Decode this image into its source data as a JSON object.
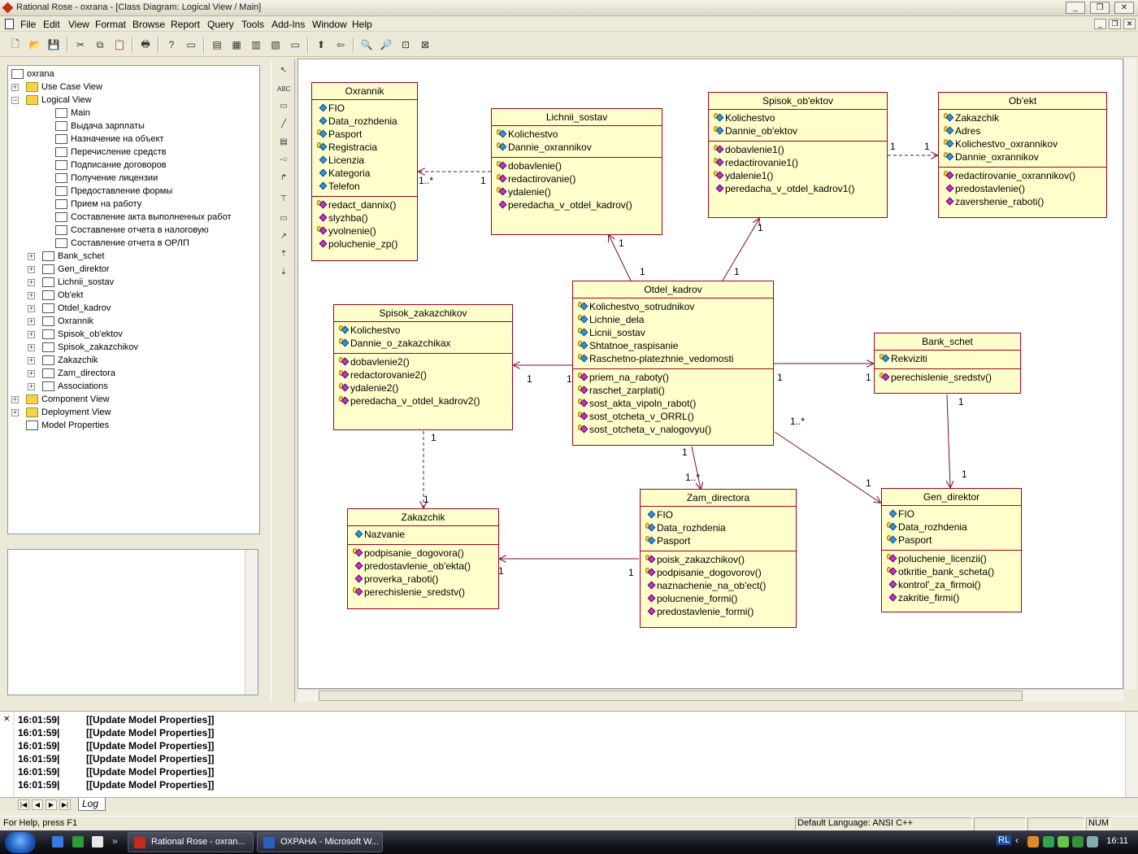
{
  "window": {
    "title": "Rational Rose - oxrana - [Class Diagram: Logical View / Main]",
    "controls": [
      "_",
      "❐",
      "✕"
    ],
    "mdi_controls": [
      "_",
      "❐",
      "✕"
    ]
  },
  "menu": [
    "File",
    "Edit",
    "View",
    "Format",
    "Browse",
    "Report",
    "Query",
    "Tools",
    "Add-Ins",
    "Window",
    "Help"
  ],
  "toolbar": {
    "icons": [
      "new-icon",
      "open-icon",
      "save-icon",
      "cut-icon",
      "copy-icon",
      "paste-icon",
      "print-icon",
      "context-help-icon",
      "view-doc-icon",
      "browse-class-icon",
      "browse-interaction-icon",
      "browse-component-icon",
      "browse-deployment-icon",
      "browse-parent-icon",
      "browse-previous-icon",
      "zoom-in-icon",
      "zoom-out-icon",
      "fit-window-icon",
      "undo-fit-icon"
    ],
    "glyphs": [
      "🗋",
      "📂",
      "💾",
      "✂",
      "⧉",
      "📋",
      "🖶",
      "?",
      "▭",
      "▤",
      "▦",
      "▥",
      "▧",
      "⬆",
      "⇦",
      "🔍",
      "🔎",
      "⊡",
      "⊠"
    ]
  },
  "browser": {
    "root": "oxrana",
    "items": [
      {
        "label": "Use Case View",
        "type": "folder",
        "expander": "+"
      },
      {
        "label": "Logical View",
        "type": "folder",
        "expander": "−"
      },
      {
        "label": "Main",
        "type": "diagram"
      },
      {
        "label": "Выдача зарплаты",
        "type": "diagram"
      },
      {
        "label": "Назначение на объект",
        "type": "diagram"
      },
      {
        "label": "Перечисление средств",
        "type": "diagram"
      },
      {
        "label": "Подписание договоров",
        "type": "diagram"
      },
      {
        "label": "Получение лицензии",
        "type": "diagram"
      },
      {
        "label": "Предоставление формы",
        "type": "diagram"
      },
      {
        "label": "Прием на работу",
        "type": "diagram"
      },
      {
        "label": "Составление акта выполненных работ",
        "type": "diagram"
      },
      {
        "label": "Составление отчета в налоговую",
        "type": "diagram"
      },
      {
        "label": "Составление отчета в ОРЛП",
        "type": "diagram"
      },
      {
        "label": "Bank_schet",
        "type": "class",
        "expander": "+"
      },
      {
        "label": "Gen_direktor",
        "type": "class",
        "expander": "+"
      },
      {
        "label": "Lichnii_sostav",
        "type": "class",
        "expander": "+"
      },
      {
        "label": "Ob'ekt",
        "type": "class",
        "expander": "+"
      },
      {
        "label": "Otdel_kadrov",
        "type": "class",
        "expander": "+"
      },
      {
        "label": "Oxrannik",
        "type": "class",
        "expander": "+"
      },
      {
        "label": "Spisok_ob'ektov",
        "type": "class",
        "expander": "+"
      },
      {
        "label": "Spisok_zakazchikov",
        "type": "class",
        "expander": "+"
      },
      {
        "label": "Zakazchik",
        "type": "class",
        "expander": "+"
      },
      {
        "label": "Zam_directora",
        "type": "class",
        "expander": "+"
      },
      {
        "label": "Associations",
        "type": "assoc",
        "expander": "+"
      },
      {
        "label": "Component View",
        "type": "folder",
        "expander": "+"
      },
      {
        "label": "Deployment View",
        "type": "folder",
        "expander": "+"
      },
      {
        "label": "Model Properties",
        "type": "props"
      }
    ]
  },
  "toolbox": [
    "↖",
    "ABC",
    "▭",
    "╱",
    "▤",
    "-○",
    "↱",
    "⊤",
    "▭",
    "↗",
    "⇡",
    "⇣"
  ],
  "classes": [
    {
      "id": "oxrannik",
      "name": "Oxrannik",
      "attrs": [
        [
          "FIO",
          "pub"
        ],
        [
          "Data_rozhdenia",
          "pub"
        ],
        [
          "Pasport",
          "key"
        ],
        [
          "Registracia",
          "key"
        ],
        [
          "Licenzia",
          "pub"
        ],
        [
          "Kategoria",
          "pub"
        ],
        [
          "Telefon",
          "pub"
        ]
      ],
      "ops": [
        [
          "redact_dannix()",
          "key"
        ],
        [
          "slyzhba()",
          "pub"
        ],
        [
          "yvolnenie()",
          "key"
        ],
        [
          "poluchenie_zp()",
          "pub"
        ]
      ]
    },
    {
      "id": "lichnii",
      "name": "Lichnii_sostav",
      "attrs": [
        [
          "Kolichestvo",
          "key"
        ],
        [
          "Dannie_oxrannikov",
          "key"
        ]
      ],
      "ops": [
        [
          "dobavlenie()",
          "key"
        ],
        [
          "redactirovanie()",
          "key"
        ],
        [
          "ydalenie()",
          "key"
        ],
        [
          "peredacha_v_otdel_kadrov()",
          "pub"
        ]
      ]
    },
    {
      "id": "spisok_obj",
      "name": "Spisok_ob'ektov",
      "attrs": [
        [
          "Kolichestvo",
          "key"
        ],
        [
          "Dannie_ob'ektov",
          "key"
        ]
      ],
      "ops": [
        [
          "dobavlenie1()",
          "key"
        ],
        [
          "redactirovanie1()",
          "key"
        ],
        [
          "ydalenie1()",
          "key"
        ],
        [
          "peredacha_v_otdel_kadrov1()",
          "pub"
        ]
      ]
    },
    {
      "id": "obekt",
      "name": "Ob'ekt",
      "attrs": [
        [
          "Zakazchik",
          "key"
        ],
        [
          "Adres",
          "key"
        ],
        [
          "Kolichestvo_oxrannikov",
          "key"
        ],
        [
          "Dannie_oxrannikov",
          "key"
        ]
      ],
      "ops": [
        [
          "redactirovanie_oxrannikov()",
          "key"
        ],
        [
          "predostavlenie()",
          "pub"
        ],
        [
          "zavershenie_raboti()",
          "pub"
        ]
      ]
    },
    {
      "id": "otdel",
      "name": "Otdel_kadrov",
      "attrs": [
        [
          "Kolichestvo_sotrudnikov",
          "key"
        ],
        [
          "Lichnie_dela",
          "key"
        ],
        [
          "Licnii_sostav",
          "key"
        ],
        [
          "Shtatnoe_raspisanie",
          "key"
        ],
        [
          "Raschetno-platezhnie_vedomosti",
          "key"
        ]
      ],
      "ops": [
        [
          "priem_na_raboty()",
          "key"
        ],
        [
          "raschet_zarplati()",
          "key"
        ],
        [
          "sost_akta_vipoln_rabot()",
          "key"
        ],
        [
          "sost_otcheta_v_ORRL()",
          "key"
        ],
        [
          "sost_otcheta_v_nalogovyu()",
          "key"
        ]
      ]
    },
    {
      "id": "spisok_zak",
      "name": "Spisok_zakazchikov",
      "attrs": [
        [
          "Kolichestvo",
          "key"
        ],
        [
          "Dannie_o_zakazchikax",
          "key"
        ]
      ],
      "ops": [
        [
          "dobavlenie2()",
          "key"
        ],
        [
          "redactorovanie2()",
          "key"
        ],
        [
          "ydalenie2()",
          "key"
        ],
        [
          "peredacha_v_otdel_kadrov2()",
          "key"
        ]
      ]
    },
    {
      "id": "bank",
      "name": "Bank_schet",
      "attrs": [
        [
          "Rekviziti",
          "key"
        ]
      ],
      "ops": [
        [
          "perechislenie_sredstv()",
          "key"
        ]
      ]
    },
    {
      "id": "zakazchik",
      "name": "Zakazchik",
      "attrs": [
        [
          "Nazvanie",
          "pub"
        ]
      ],
      "ops": [
        [
          "podpisanie_dogovora()",
          "key"
        ],
        [
          "predostavlenie_ob'ekta()",
          "pub"
        ],
        [
          "proverka_raboti()",
          "pub"
        ],
        [
          "perechislenie_sredstv()",
          "key"
        ]
      ]
    },
    {
      "id": "zam",
      "name": "Zam_directora",
      "attrs": [
        [
          "FIO",
          "pub"
        ],
        [
          "Data_rozhdenia",
          "key"
        ],
        [
          "Pasport",
          "key"
        ]
      ],
      "ops": [
        [
          "poisk_zakazchikov()",
          "key"
        ],
        [
          "podpisanie_dogovorov()",
          "key"
        ],
        [
          "naznachenie_na_ob'ect()",
          "pub"
        ],
        [
          "polucnenie_formi()",
          "pub"
        ],
        [
          "predostavlenie_formi()",
          "pub"
        ]
      ]
    },
    {
      "id": "gen",
      "name": "Gen_direktor",
      "attrs": [
        [
          "FIO",
          "pub"
        ],
        [
          "Data_rozhdenia",
          "key"
        ],
        [
          "Pasport",
          "key"
        ]
      ],
      "ops": [
        [
          "poluchenie_licenzii()",
          "key"
        ],
        [
          "otkritie_bank_scheta()",
          "key"
        ],
        [
          "kontrol'_za_firmoi()",
          "pub"
        ],
        [
          "zakritie_firmi()",
          "pub"
        ]
      ]
    }
  ],
  "multiplicities": [
    "1..*",
    "1",
    "1",
    "1",
    "1",
    "1",
    "1",
    "1",
    "1",
    "1",
    "1",
    "1",
    "1",
    "1..*",
    "1..*",
    "1",
    "1",
    "1",
    "1",
    "1",
    "1",
    "1",
    "1"
  ],
  "log": {
    "lines": [
      {
        "time": "16:01:59|",
        "msg": "[[Update Model Properties]]"
      },
      {
        "time": "16:01:59|",
        "msg": "[[Update Model Properties]]"
      },
      {
        "time": "16:01:59|",
        "msg": "[[Update Model Properties]]"
      },
      {
        "time": "16:01:59|",
        "msg": "[[Update Model Properties]]"
      },
      {
        "time": "16:01:59|",
        "msg": "[[Update Model Properties]]"
      },
      {
        "time": "16:01:59|",
        "msg": "[[Update Model Properties]]"
      }
    ],
    "tab": "Log",
    "nav": [
      "|◀",
      "◀",
      "▶",
      "▶|"
    ]
  },
  "status": {
    "help": "For Help, press F1",
    "language": "Default Language: ANSI C++",
    "num": "NUM"
  },
  "taskbar": {
    "buttons": [
      {
        "label": "Rational Rose - oxran...",
        "color": "#c62b1c"
      },
      {
        "label": "ОХРАНА - Microsoft W...",
        "color": "#2b5fb8"
      }
    ],
    "lang": "RL",
    "clock": "16:11"
  }
}
